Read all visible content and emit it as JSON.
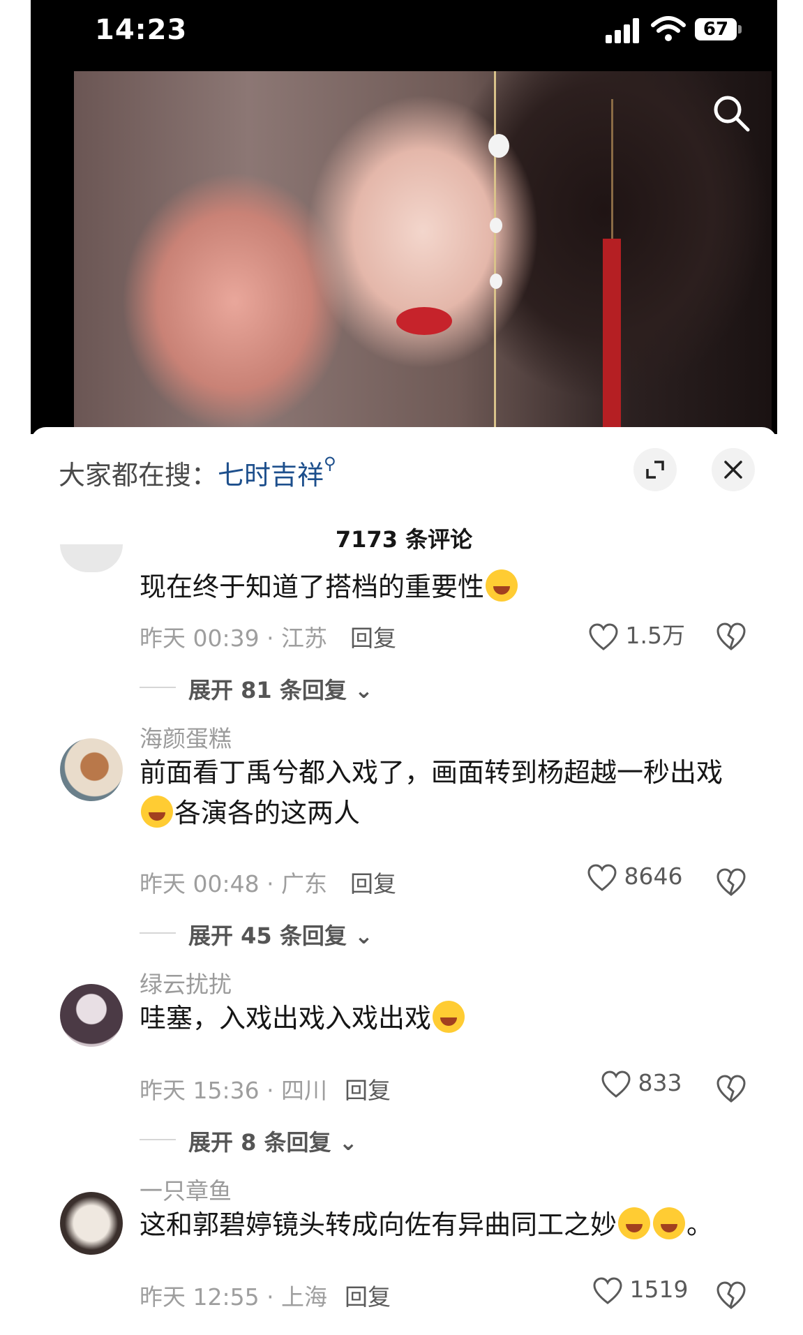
{
  "status_bar": {
    "time": "14:23",
    "battery": "67"
  },
  "video": {
    "search_icon": "search-icon"
  },
  "sheet": {
    "hot_search_label": "大家都在搜：",
    "hot_search_term": "七时吉祥",
    "comment_count": "7173 条评论",
    "icons": {
      "expand": "expand-icon",
      "close": "close-icon"
    }
  },
  "comments": [
    {
      "text": "现在终于知道了搭档的重要性",
      "time_location": "昨天 00:39 · 江苏",
      "reply": "回复",
      "likes": "1.5万",
      "expand": "展开 81 条回复"
    },
    {
      "username": "海颜蛋糕",
      "text_line1": "前面看丁禹兮都入戏了，画面转到杨超越一秒出戏",
      "text_line2": "各演各的这两人",
      "time_location": "昨天 00:48 · 广东",
      "reply": "回复",
      "likes": "8646",
      "expand": "展开 45 条回复"
    },
    {
      "username": "绿云扰扰",
      "text": "哇塞，入戏出戏入戏出戏",
      "time_location": "昨天 15:36 · 四川",
      "reply": "回复",
      "likes": "833",
      "expand": "展开 8 条回复"
    },
    {
      "username": "一只章鱼",
      "text": "这和郭碧婷镜头转成向佐有异曲同工之妙",
      "text_tail": "。",
      "time_location": "昨天 12:55 · 上海",
      "reply": "回复",
      "likes": "1519"
    }
  ]
}
